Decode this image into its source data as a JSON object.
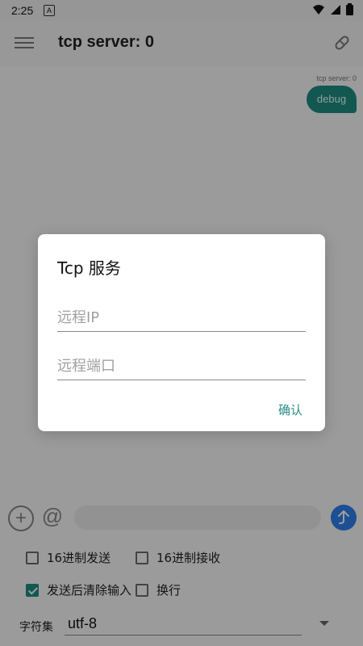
{
  "status": {
    "time": "2:25",
    "notification_badge": "A"
  },
  "header": {
    "title": "tcp server: 0"
  },
  "message": {
    "meta": "tcp server: 0",
    "text": "debug"
  },
  "input": {
    "placeholder": ""
  },
  "options": {
    "hex_send": "16进制发送",
    "hex_receive": "16进制接收",
    "clear_after_send": "发送后清除输入",
    "newline": "换行"
  },
  "charset": {
    "label": "字符集",
    "value": "utf-8"
  },
  "dialog": {
    "title": "Tcp 服务",
    "remote_ip_placeholder": "远程IP",
    "remote_port_placeholder": "远程端口",
    "confirm_label": "确认"
  },
  "colors": {
    "accent": "#1d8f84",
    "send_button": "#2f80ee",
    "overlay": "rgba(0,0,0,0.38)"
  },
  "icons": [
    "menu-icon",
    "link-icon",
    "plus-icon",
    "at-icon",
    "send-icon",
    "wifi-icon",
    "signal-icon",
    "battery-icon",
    "chevron-down-icon"
  ]
}
